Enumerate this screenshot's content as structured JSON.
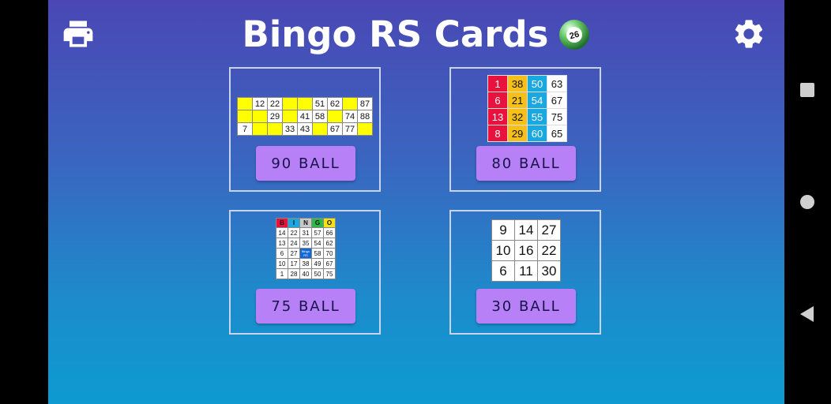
{
  "app": {
    "title": "Bingo RS Cards",
    "ball_number": "26"
  },
  "toolbar": {
    "print_icon": "print-icon",
    "settings_icon": "gear-icon"
  },
  "cards": {
    "ball90": {
      "button_label": "90 BALL",
      "rows": [
        [
          "",
          "12",
          "22",
          "",
          "",
          "51",
          "62",
          "",
          "87"
        ],
        [
          "",
          "",
          "29",
          "",
          "41",
          "58",
          "",
          "74",
          "88"
        ],
        [
          "7",
          "",
          "",
          "33",
          "43",
          "",
          "67",
          "77",
          ""
        ]
      ]
    },
    "ball80": {
      "button_label": "80 BALL",
      "rows": [
        [
          "1",
          "38",
          "50",
          "63"
        ],
        [
          "6",
          "21",
          "54",
          "67"
        ],
        [
          "13",
          "32",
          "55",
          "75"
        ],
        [
          "8",
          "29",
          "60",
          "65"
        ]
      ],
      "column_colors": [
        "#e8123c",
        "#f6c018",
        "#1aa8e0",
        "#ffffff"
      ]
    },
    "ball75": {
      "button_label": "75 BALL",
      "header": [
        "B",
        "I",
        "N",
        "G",
        "O"
      ],
      "header_colors": [
        "#e8123c",
        "#1aa8e0",
        "#c8c8c8",
        "#2fb84a",
        "#f6e018"
      ],
      "rows": [
        [
          "14",
          "22",
          "31",
          "57",
          "66"
        ],
        [
          "13",
          "24",
          "35",
          "54",
          "62"
        ],
        [
          "6",
          "27",
          "Bingo RS",
          "58",
          "70"
        ],
        [
          "10",
          "17",
          "38",
          "49",
          "67"
        ],
        [
          "1",
          "28",
          "40",
          "50",
          "75"
        ]
      ]
    },
    "ball30": {
      "button_label": "30 BALL",
      "rows": [
        [
          "9",
          "14",
          "27"
        ],
        [
          "10",
          "16",
          "22"
        ],
        [
          "6",
          "11",
          "30"
        ]
      ]
    }
  },
  "system_nav": {
    "recents_icon": "square-icon",
    "home_icon": "circle-icon",
    "back_icon": "triangle-back-icon"
  }
}
